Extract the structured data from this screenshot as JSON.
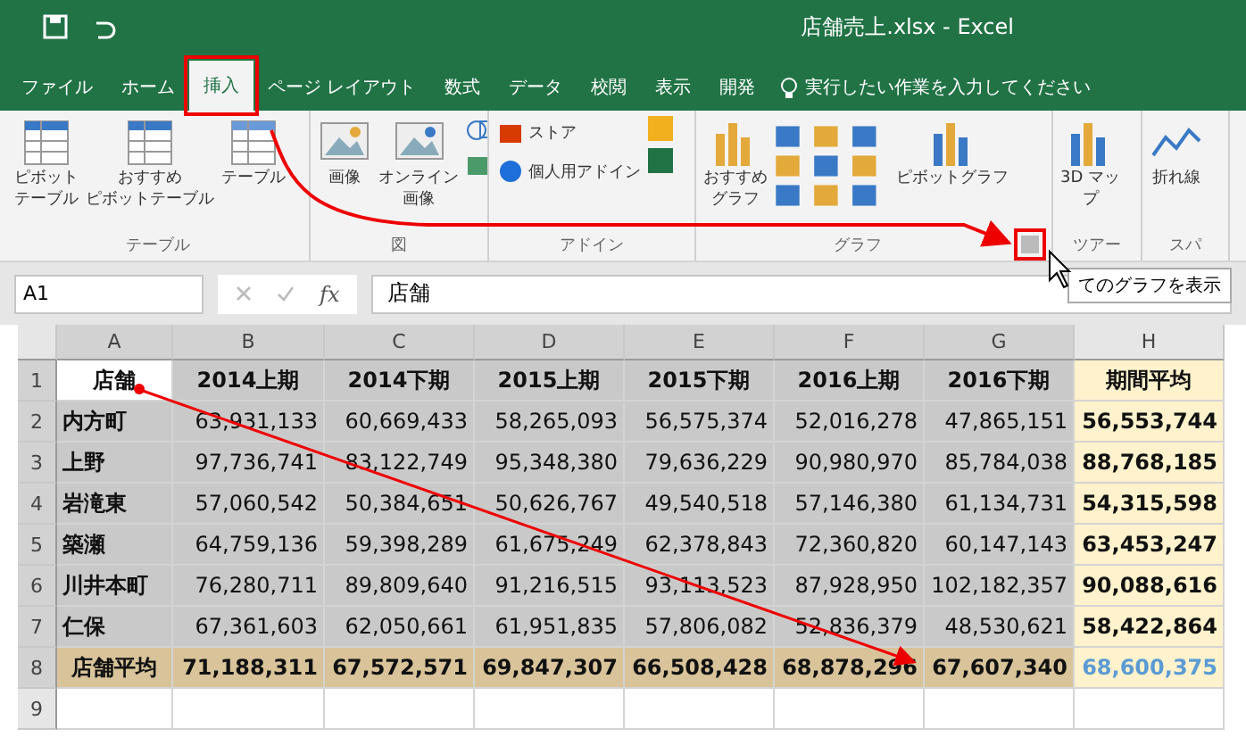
{
  "window": {
    "title": "店舗売上.xlsx - Excel"
  },
  "tabs": [
    {
      "label": "ファイル",
      "selected": false,
      "highlighted": false
    },
    {
      "label": "ホーム",
      "selected": false,
      "highlighted": false
    },
    {
      "label": "挿入",
      "selected": true,
      "highlighted": true
    },
    {
      "label": "ページ レイアウト",
      "selected": false,
      "highlighted": false
    },
    {
      "label": "数式",
      "selected": false,
      "highlighted": false
    },
    {
      "label": "データ",
      "selected": false,
      "highlighted": false
    },
    {
      "label": "校閲",
      "selected": false,
      "highlighted": false
    },
    {
      "label": "表示",
      "selected": false,
      "highlighted": false
    },
    {
      "label": "開発",
      "selected": false,
      "highlighted": false
    }
  ],
  "tell_me": {
    "placeholder": "実行したい作業を入力してください"
  },
  "ribbon_groups": [
    {
      "label": "テーブル",
      "buttons": [
        {
          "kind": "pivot",
          "label_lines": [
            "ピボット",
            "テーブル"
          ]
        },
        {
          "kind": "recommend-pivot",
          "label_lines": [
            "おすすめ",
            "ピボットテーブル"
          ]
        },
        {
          "kind": "table",
          "label_lines": [
            "テーブル"
          ]
        }
      ]
    },
    {
      "label": "図",
      "buttons": [
        {
          "kind": "image",
          "label_lines": [
            "画像"
          ]
        },
        {
          "kind": "online-image",
          "label_lines": [
            "オンライン",
            "画像"
          ]
        },
        {
          "kind": "shapes"
        }
      ]
    },
    {
      "label": "アドイン",
      "buttons": [
        {
          "kind": "store",
          "label_lines": [
            "ストア"
          ]
        },
        {
          "kind": "my-addins",
          "label_lines": [
            "個人用アドイン"
          ]
        }
      ]
    },
    {
      "label": "グラフ",
      "launcher": {
        "highlighted": true
      },
      "buttons": [
        {
          "kind": "recommend-chart",
          "label_lines": [
            "おすすめ",
            "グラフ"
          ]
        },
        {
          "kind": "chart-grid"
        },
        {
          "kind": "pivot-chart",
          "label_lines": [
            "ピボットグラフ"
          ]
        }
      ]
    },
    {
      "label": "ツアー",
      "buttons": [
        {
          "kind": "map",
          "label_lines": [
            "3D マッ",
            "プ"
          ]
        }
      ]
    },
    {
      "label": "スパ",
      "buttons": [
        {
          "kind": "line",
          "label_lines": [
            "折れ線"
          ]
        }
      ]
    }
  ],
  "tooltip": "てのグラフを表示",
  "name_box": "A1",
  "function_label": "fx",
  "formula": "店舗",
  "columns": [
    "A",
    "B",
    "C",
    "D",
    "E",
    "F",
    "G",
    "H"
  ],
  "rows": [
    {
      "number": "1",
      "kind": "header",
      "selected": true,
      "cells": [
        "店舗",
        "2014上期",
        "2014下期",
        "2015上期",
        "2015下期",
        "2016上期",
        "2016下期",
        "期間平均"
      ]
    },
    {
      "number": "2",
      "kind": "data",
      "selected": true,
      "cells": [
        "内方町",
        "63,931,133",
        "60,669,433",
        "58,265,093",
        "56,575,374",
        "52,016,278",
        "47,865,151",
        "56,553,744"
      ]
    },
    {
      "number": "3",
      "kind": "data",
      "selected": true,
      "cells": [
        "上野",
        "97,736,741",
        "83,122,749",
        "95,348,380",
        "79,636,229",
        "90,980,970",
        "85,784,038",
        "88,768,185"
      ]
    },
    {
      "number": "4",
      "kind": "data",
      "selected": true,
      "cells": [
        "岩滝東",
        "57,060,542",
        "50,384,651",
        "50,626,767",
        "49,540,518",
        "57,146,380",
        "61,134,731",
        "54,315,598"
      ]
    },
    {
      "number": "5",
      "kind": "data",
      "selected": true,
      "cells": [
        "築瀬",
        "64,759,136",
        "59,398,289",
        "61,675,249",
        "62,378,843",
        "72,360,820",
        "60,147,143",
        "63,453,247"
      ]
    },
    {
      "number": "6",
      "kind": "data",
      "selected": true,
      "cells": [
        "川井本町",
        "76,280,711",
        "89,809,640",
        "91,216,515",
        "93,113,523",
        "87,928,950",
        "102,182,357",
        "90,088,616"
      ]
    },
    {
      "number": "7",
      "kind": "data",
      "selected": true,
      "cells": [
        "仁保",
        "67,361,603",
        "62,050,661",
        "61,951,835",
        "57,806,082",
        "52,836,379",
        "48,530,621",
        "58,422,864"
      ]
    },
    {
      "number": "8",
      "kind": "total",
      "selected": true,
      "cells": [
        "店舗平均",
        "71,188,311",
        "67,572,571",
        "69,847,307",
        "66,508,428",
        "68,878,296",
        "67,607,340",
        "68,600,375"
      ]
    },
    {
      "number": "9",
      "kind": "empty",
      "selected": false,
      "cells": []
    }
  ]
}
